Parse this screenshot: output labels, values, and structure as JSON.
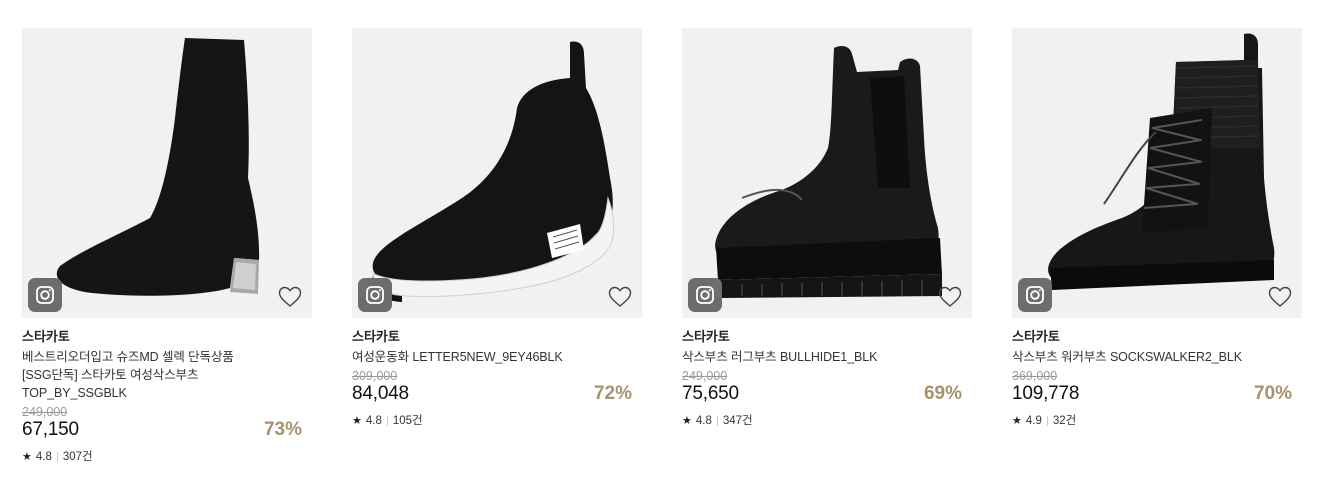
{
  "products": [
    {
      "brand": "스타카토",
      "name_lines": [
        "베스트리오더입고 슈즈MD 셀렉 단독상품",
        "[SSG단독] 스타카토 여성삭스부츠",
        "TOP_BY_SSGBLK"
      ],
      "original_price": "249,000",
      "price": "67,150",
      "discount": "73%",
      "rating": "4.8",
      "review_count": "307건",
      "icon": "sock-heel-boot-image"
    },
    {
      "brand": "스타카토",
      "name_lines": [
        "여성운동화 LETTER5NEW_9EY46BLK"
      ],
      "original_price": "309,000",
      "price": "84,048",
      "discount": "72%",
      "rating": "4.8",
      "review_count": "105건",
      "icon": "sock-sneaker-image"
    },
    {
      "brand": "스타카토",
      "name_lines": [
        "삭스부츠 러그부츠 BULLHIDE1_BLK"
      ],
      "original_price": "249,000",
      "price": "75,650",
      "discount": "69%",
      "rating": "4.8",
      "review_count": "347건",
      "icon": "chelsea-boot-image"
    },
    {
      "brand": "스타카토",
      "name_lines": [
        "삭스부츠 워커부츠 SOCKSWALKER2_BLK"
      ],
      "original_price": "369,000",
      "price": "109,778",
      "discount": "70%",
      "rating": "4.9",
      "review_count": "32건",
      "icon": "lace-up-walker-boot-image"
    }
  ],
  "colors": {
    "discount": "#a7926b",
    "image_bg": "#f1f1f1",
    "badge": "#6d6d6d"
  }
}
